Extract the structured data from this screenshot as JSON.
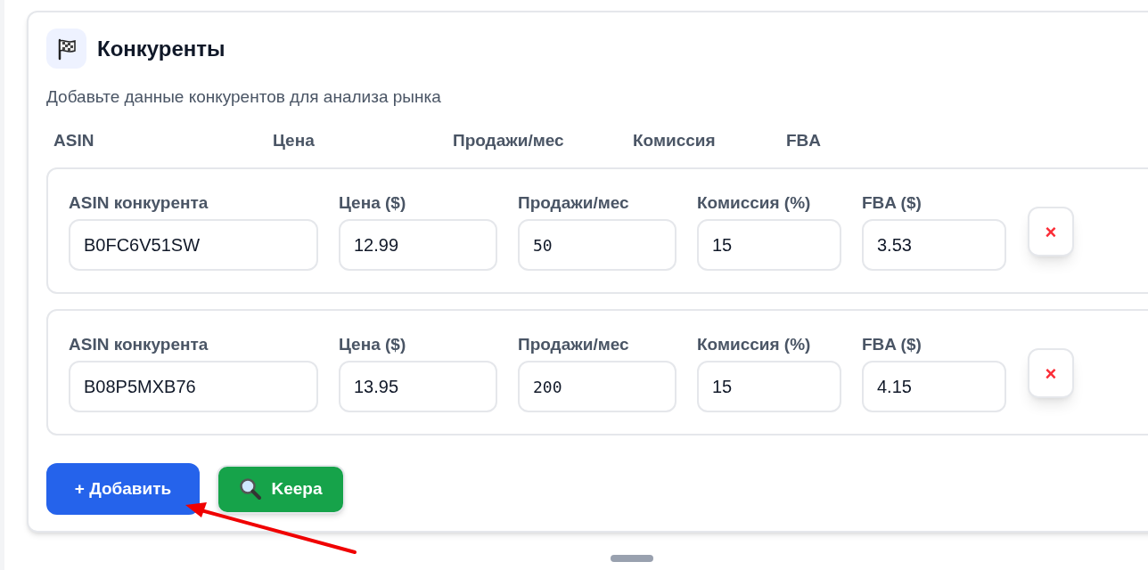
{
  "panel": {
    "title": "Конкуренты",
    "subtitle": "Добавьте данные конкурентов для анализа рынка"
  },
  "columns": [
    "ASIN",
    "Цена",
    "Продажи/мес",
    "Комиссия",
    "FBA"
  ],
  "competitors": [
    {
      "fields": [
        {
          "label": "ASIN конкурента",
          "value": "B0FC6V51SW",
          "kind": "text"
        },
        {
          "label": "Цена ($)",
          "value": "12.99",
          "kind": "text"
        },
        {
          "label": "Продажи/мес",
          "value": "50",
          "kind": "mono"
        },
        {
          "label": "Комиссия (%)",
          "value": "15",
          "kind": "text"
        },
        {
          "label": "FBA ($)",
          "value": "3.53",
          "kind": "text"
        }
      ],
      "remove": "×"
    },
    {
      "fields": [
        {
          "label": "ASIN конкурента",
          "value": "B08P5MXB76",
          "kind": "text"
        },
        {
          "label": "Цена ($)",
          "value": "13.95",
          "kind": "text"
        },
        {
          "label": "Продажи/мес",
          "value": "200",
          "kind": "mono"
        },
        {
          "label": "Комиссия (%)",
          "value": "15",
          "kind": "text"
        },
        {
          "label": "FBA ($)",
          "value": "4.15",
          "kind": "text"
        }
      ],
      "remove": "×"
    }
  ],
  "buttons": [
    {
      "label": "+ Добавить",
      "kind": "primary"
    },
    {
      "label": "Keepa",
      "kind": "keepa"
    }
  ]
}
